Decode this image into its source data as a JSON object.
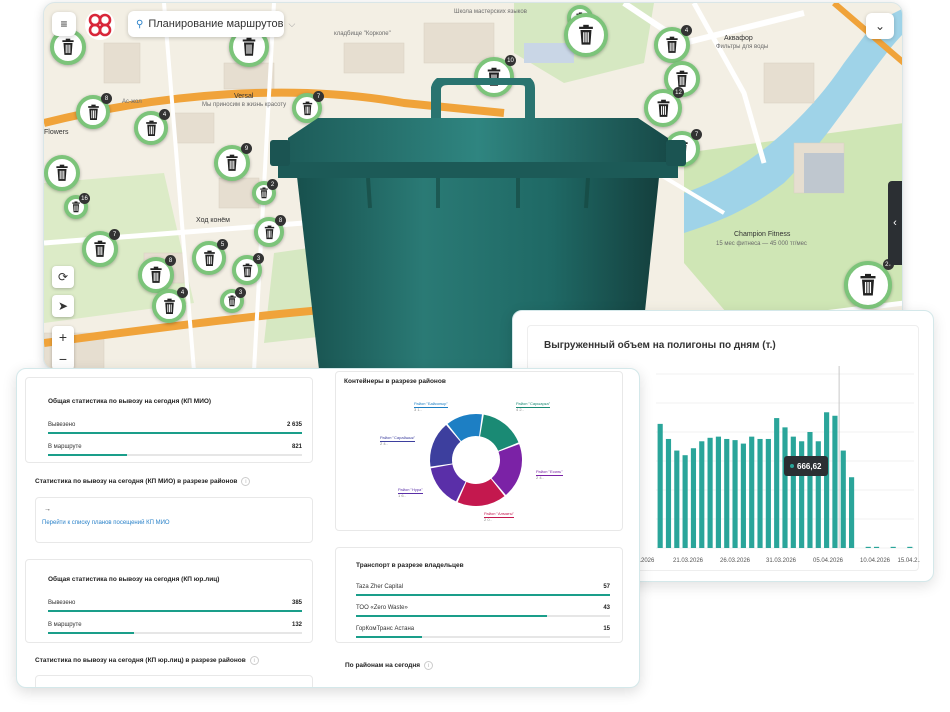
{
  "map": {
    "route_select_label": "Планирование маршрутов",
    "labels": {
      "cemetery": "кладбище \"Коркопе\"",
      "school": "Школа мастерских языков",
      "aquafor": "Аквафор",
      "aquafor_sub": "Фильтры для воды",
      "champion": "Champion Fitness",
      "champion_sub": "15 мес фитнеса — 45 000 тг/мес",
      "hod_konem": "Ход конём",
      "versal": "Versal",
      "versal_sub": "Мы приносим в жизнь красоту",
      "flowers": "Flowers",
      "klubnichka": "Ас-жол"
    },
    "markers": [
      {
        "count": "",
        "icon": "trash-icon"
      },
      {
        "count": "",
        "icon": "trash-icon"
      },
      {
        "count": "",
        "icon": "trash-icon"
      },
      {
        "count": "10",
        "icon": "trash-icon"
      },
      {
        "count": "",
        "icon": "trash-icon"
      },
      {
        "count": "4",
        "icon": "trash-icon"
      },
      {
        "count": "",
        "icon": "trash-icon"
      },
      {
        "count": "4",
        "icon": "trash-icon"
      },
      {
        "count": "9",
        "icon": "trash-icon"
      },
      {
        "count": "",
        "icon": "trash-icon"
      },
      {
        "count": "16",
        "icon": "trash-icon"
      },
      {
        "count": "7",
        "icon": "trash-icon"
      },
      {
        "count": "8",
        "icon": "trash-icon"
      },
      {
        "count": "5",
        "icon": "trash-icon"
      },
      {
        "count": "3",
        "icon": "trash-icon"
      },
      {
        "count": "4",
        "icon": "trash-icon"
      },
      {
        "count": "2",
        "icon": "trash-icon"
      },
      {
        "count": "3",
        "icon": "trash-icon"
      },
      {
        "count": "12",
        "icon": "trash-icon"
      },
      {
        "count": "7",
        "icon": "trash-icon"
      },
      {
        "count": "27",
        "icon": "trash-icon"
      },
      {
        "count": "8",
        "icon": "trash-icon"
      },
      {
        "count": "7",
        "icon": "trash-icon"
      },
      {
        "count": "8",
        "icon": "trash-icon"
      }
    ],
    "zoom_in": "+",
    "zoom_out": "−"
  },
  "chart": {
    "title": "Выгруженный объем на полигоны по дням (т.)",
    "tooltip_value": "666,62",
    "x_ticks": [
      "6.03.2026",
      "21.03.2026",
      "26.03.2026",
      "31.03.2026",
      "05.04.2026",
      "10.04.2026",
      "15.04.2..."
    ]
  },
  "chart_data": {
    "type": "bar",
    "title": "Выгруженный объем на полигоны по дням (т.)",
    "xlabel": "",
    "ylabel": "",
    "x_ticks": [
      "6.03.2026",
      "21.03.2026",
      "26.03.2026",
      "31.03.2026",
      "05.04.2026",
      "10.04.2026",
      "15.04.2..."
    ],
    "values": [
      535,
      470,
      420,
      400,
      430,
      460,
      475,
      480,
      470,
      465,
      450,
      480,
      470,
      470,
      560,
      520,
      480,
      460,
      500,
      460,
      585,
      570,
      420,
      305,
      0,
      5,
      5,
      0,
      5,
      0,
      5
    ],
    "highlighted_value": 666.62,
    "ylim": [
      0,
      750
    ],
    "grid": true,
    "color": "#2aa59a"
  },
  "stats_mio": {
    "title": "Общая статистика по вывозу на сегодня (КП МИО)",
    "rows": [
      {
        "name": "Вывезено",
        "value": "2 635",
        "fraction": 1.0
      },
      {
        "name": "В маршруте",
        "value": "821",
        "fraction": 0.31
      }
    ]
  },
  "districts_mio": {
    "title": "Статистика по вывозу на сегодня (КП МИО) в разрезе районов",
    "arrow": "→",
    "link": "Перейти к списку планов посещений КП МИО"
  },
  "stats_legal": {
    "title": "Общая статистика по вывозу на сегодня (КП юр.лиц)",
    "rows": [
      {
        "name": "Вывезено",
        "value": "385",
        "fraction": 1.0
      },
      {
        "name": "В маршруте",
        "value": "132",
        "fraction": 0.34
      }
    ]
  },
  "districts_legal": {
    "title": "Статистика по вывозу на сегодня (КП юр.лиц) в разрезе районов"
  },
  "containers": {
    "title": "Контейнеры в разрезе районов",
    "slices": [
      {
        "name": "Район \"Сарыарка\"",
        "sub": "4 2..",
        "value": 15,
        "color": "#1a8a74"
      },
      {
        "name": "Район \"Есиль\"",
        "sub": "2 4..",
        "value": 18,
        "color": "#7b22a6"
      },
      {
        "name": "Район \"Алматы\"",
        "sub": "2 0..",
        "value": 16,
        "color": "#c4184e"
      },
      {
        "name": "Район \"Нура\"",
        "sub": "1 6..",
        "value": 14,
        "color": "#5a2fa8"
      },
      {
        "name": "Район \"Сарайшык\"",
        "sub": "2 4..",
        "value": 15,
        "color": "#3d3f9e"
      },
      {
        "name": "Район \"Байконыр\"",
        "sub": "3 1..",
        "value": 12,
        "color": "#1d7fc4"
      }
    ]
  },
  "transport": {
    "title": "Транспорт в разрезе владельцев",
    "rows": [
      {
        "name": "Taza Zher Capital",
        "value": "57",
        "fraction": 1.0
      },
      {
        "name": "ТОО «Zero Waste»",
        "value": "43",
        "fraction": 0.75
      },
      {
        "name": "ГорКомТранс Астана",
        "value": "15",
        "fraction": 0.26
      }
    ]
  },
  "districts_today": {
    "title": "По районам на сегодня"
  },
  "colors": {
    "accent": "#1a9e8a",
    "marker_ring": "#7cc47a",
    "road": "#f0a33a",
    "water": "#9fd3e8",
    "park": "#cfe6b5",
    "bin": "#1f6b67"
  }
}
